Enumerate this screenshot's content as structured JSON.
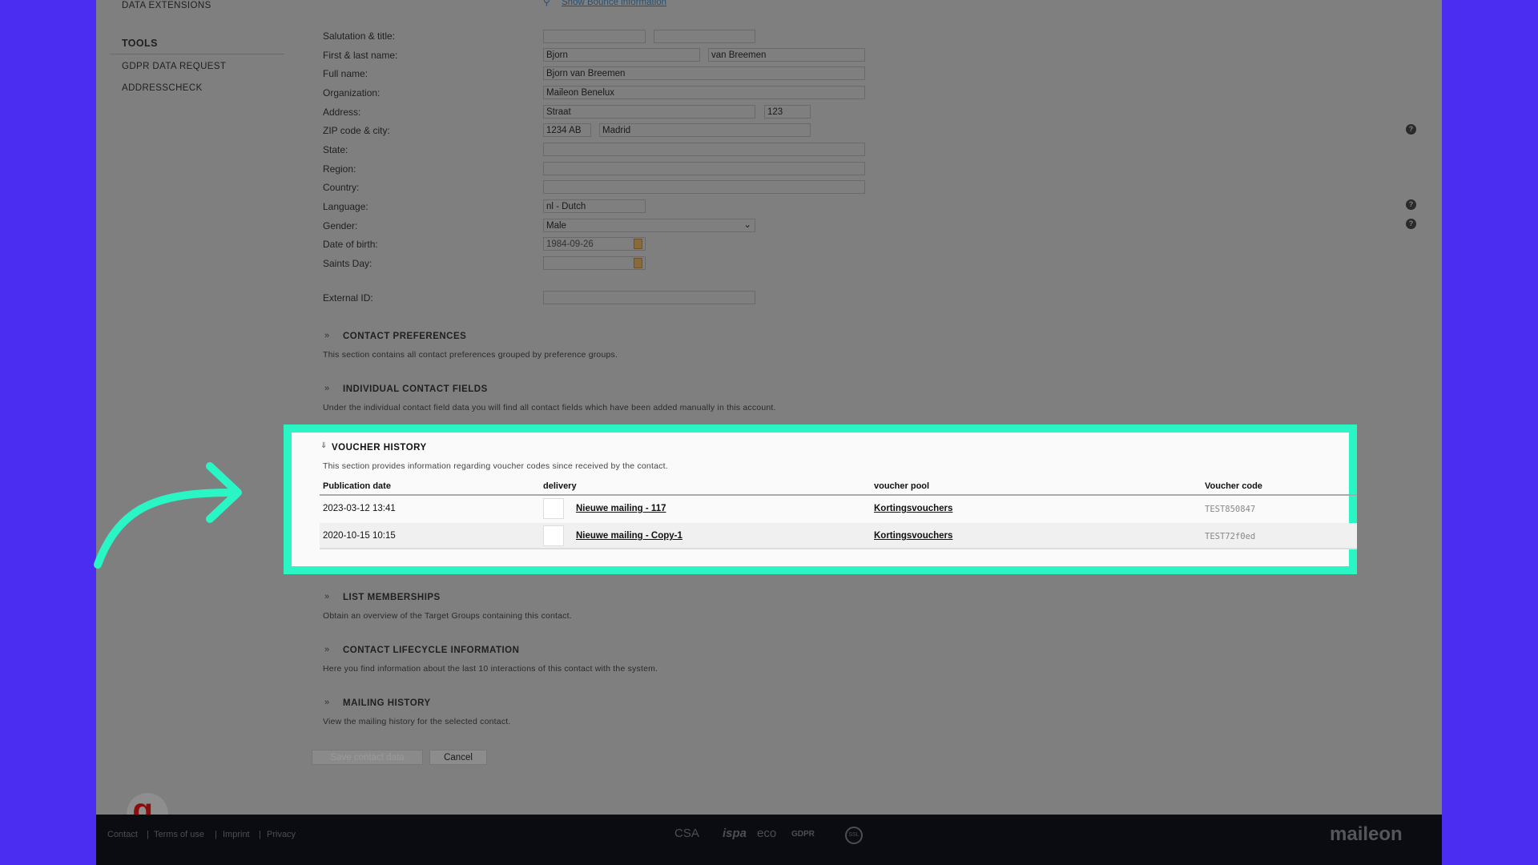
{
  "sidebar": {
    "data_extensions": "DATA EXTENSIONS",
    "tools_heading": "TOOLS",
    "items": [
      "GDPR DATA REQUEST",
      "ADDRESSCHECK"
    ]
  },
  "bounce_link": "Show Bounce information",
  "form": {
    "salutation_label": "Salutation & title:",
    "salutation": "",
    "title": "",
    "name_label": "First & last name:",
    "first_name": "Bjorn",
    "last_name": "van Breemen",
    "fullname_label": "Full name:",
    "full_name": "Bjorn van Breemen",
    "org_label": "Organization:",
    "organization": "Maileon Benelux",
    "address_label": "Address:",
    "street": "Straat",
    "number": "123",
    "zip_label": "ZIP code & city:",
    "zip": "1234 AB",
    "city": "Madrid",
    "state_label": "State:",
    "state": "",
    "region_label": "Region:",
    "region": "",
    "country_label": "Country:",
    "country": "",
    "language_label": "Language:",
    "language": "nl - Dutch",
    "gender_label": "Gender:",
    "gender": "Male",
    "dob_label": "Date of birth:",
    "dob": "1984-09-26",
    "saints_label": "Saints Day:",
    "saints": "",
    "extid_label": "External ID:",
    "external_id": ""
  },
  "sections": {
    "contact_prefs": {
      "title": "CONTACT PREFERENCES",
      "desc": "This section contains all contact preferences grouped by preference groups."
    },
    "individual": {
      "title": "INDIVIDUAL CONTACT FIELDS",
      "desc": "Under the individual contact field data you will find all contact fields which have been added manually in this account."
    },
    "voucher": {
      "title": "VOUCHER HISTORY",
      "desc": "This section provides information regarding voucher codes since received by the contact.",
      "columns": [
        "Publication date",
        "delivery",
        "voucher pool",
        "Voucher code"
      ],
      "rows": [
        {
          "date": "2023-03-12 13:41",
          "delivery": "Nieuwe mailing - 117",
          "pool": "Kortingsvouchers",
          "code": "TEST850847"
        },
        {
          "date": "2020-10-15 10:15",
          "delivery": "Nieuwe mailing - Copy-1",
          "pool": "Kortingsvouchers",
          "code": "TEST72f0ed"
        }
      ]
    },
    "lists": {
      "title": "LIST MEMBERSHIPS",
      "desc": "Obtain an overview of the Target Groups containing this contact."
    },
    "lifecycle": {
      "title": "CONTACT LIFECYCLE INFORMATION",
      "desc": "Here you find information about the last 10 interactions of this contact with the system."
    },
    "mailing": {
      "title": "MAILING HISTORY",
      "desc": "View the mailing history for the selected contact."
    }
  },
  "buttons": {
    "save": "Save contact data",
    "cancel": "Cancel"
  },
  "footer": {
    "links": [
      "Contact",
      "Terms of use",
      "Imprint",
      "Privacy"
    ],
    "sep": "|",
    "badges": [
      "CSA",
      "ispa",
      "eco",
      "GDPR",
      "SSL"
    ],
    "brand": "maileon"
  },
  "colors": {
    "highlight": "#2af5c5",
    "background": "#4a2df0"
  }
}
